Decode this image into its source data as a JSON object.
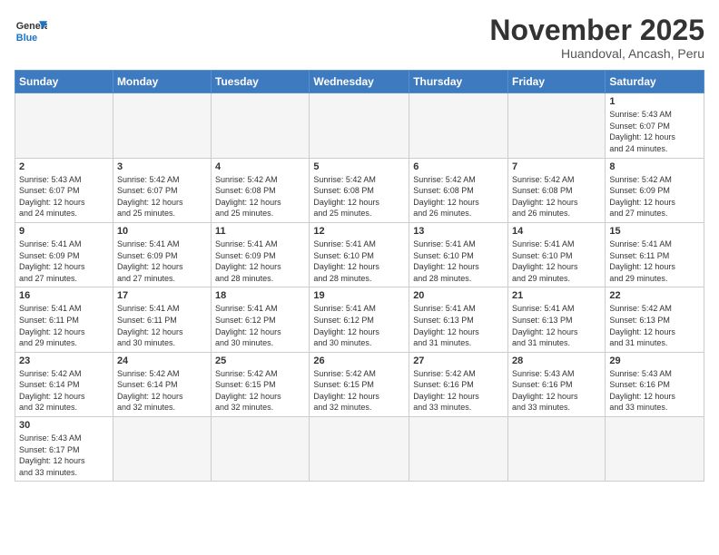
{
  "header": {
    "logo_general": "General",
    "logo_blue": "Blue",
    "month": "November 2025",
    "location": "Huandoval, Ancash, Peru"
  },
  "days_of_week": [
    "Sunday",
    "Monday",
    "Tuesday",
    "Wednesday",
    "Thursday",
    "Friday",
    "Saturday"
  ],
  "weeks": [
    [
      {
        "day": "",
        "info": ""
      },
      {
        "day": "",
        "info": ""
      },
      {
        "day": "",
        "info": ""
      },
      {
        "day": "",
        "info": ""
      },
      {
        "day": "",
        "info": ""
      },
      {
        "day": "",
        "info": ""
      },
      {
        "day": "1",
        "info": "Sunrise: 5:43 AM\nSunset: 6:07 PM\nDaylight: 12 hours\nand 24 minutes."
      }
    ],
    [
      {
        "day": "2",
        "info": "Sunrise: 5:43 AM\nSunset: 6:07 PM\nDaylight: 12 hours\nand 24 minutes."
      },
      {
        "day": "3",
        "info": "Sunrise: 5:42 AM\nSunset: 6:07 PM\nDaylight: 12 hours\nand 25 minutes."
      },
      {
        "day": "4",
        "info": "Sunrise: 5:42 AM\nSunset: 6:08 PM\nDaylight: 12 hours\nand 25 minutes."
      },
      {
        "day": "5",
        "info": "Sunrise: 5:42 AM\nSunset: 6:08 PM\nDaylight: 12 hours\nand 25 minutes."
      },
      {
        "day": "6",
        "info": "Sunrise: 5:42 AM\nSunset: 6:08 PM\nDaylight: 12 hours\nand 26 minutes."
      },
      {
        "day": "7",
        "info": "Sunrise: 5:42 AM\nSunset: 6:08 PM\nDaylight: 12 hours\nand 26 minutes."
      },
      {
        "day": "8",
        "info": "Sunrise: 5:42 AM\nSunset: 6:09 PM\nDaylight: 12 hours\nand 27 minutes."
      }
    ],
    [
      {
        "day": "9",
        "info": "Sunrise: 5:41 AM\nSunset: 6:09 PM\nDaylight: 12 hours\nand 27 minutes."
      },
      {
        "day": "10",
        "info": "Sunrise: 5:41 AM\nSunset: 6:09 PM\nDaylight: 12 hours\nand 27 minutes."
      },
      {
        "day": "11",
        "info": "Sunrise: 5:41 AM\nSunset: 6:09 PM\nDaylight: 12 hours\nand 28 minutes."
      },
      {
        "day": "12",
        "info": "Sunrise: 5:41 AM\nSunset: 6:10 PM\nDaylight: 12 hours\nand 28 minutes."
      },
      {
        "day": "13",
        "info": "Sunrise: 5:41 AM\nSunset: 6:10 PM\nDaylight: 12 hours\nand 28 minutes."
      },
      {
        "day": "14",
        "info": "Sunrise: 5:41 AM\nSunset: 6:10 PM\nDaylight: 12 hours\nand 29 minutes."
      },
      {
        "day": "15",
        "info": "Sunrise: 5:41 AM\nSunset: 6:11 PM\nDaylight: 12 hours\nand 29 minutes."
      }
    ],
    [
      {
        "day": "16",
        "info": "Sunrise: 5:41 AM\nSunset: 6:11 PM\nDaylight: 12 hours\nand 29 minutes."
      },
      {
        "day": "17",
        "info": "Sunrise: 5:41 AM\nSunset: 6:11 PM\nDaylight: 12 hours\nand 30 minutes."
      },
      {
        "day": "18",
        "info": "Sunrise: 5:41 AM\nSunset: 6:12 PM\nDaylight: 12 hours\nand 30 minutes."
      },
      {
        "day": "19",
        "info": "Sunrise: 5:41 AM\nSunset: 6:12 PM\nDaylight: 12 hours\nand 30 minutes."
      },
      {
        "day": "20",
        "info": "Sunrise: 5:41 AM\nSunset: 6:13 PM\nDaylight: 12 hours\nand 31 minutes."
      },
      {
        "day": "21",
        "info": "Sunrise: 5:41 AM\nSunset: 6:13 PM\nDaylight: 12 hours\nand 31 minutes."
      },
      {
        "day": "22",
        "info": "Sunrise: 5:42 AM\nSunset: 6:13 PM\nDaylight: 12 hours\nand 31 minutes."
      }
    ],
    [
      {
        "day": "23",
        "info": "Sunrise: 5:42 AM\nSunset: 6:14 PM\nDaylight: 12 hours\nand 32 minutes."
      },
      {
        "day": "24",
        "info": "Sunrise: 5:42 AM\nSunset: 6:14 PM\nDaylight: 12 hours\nand 32 minutes."
      },
      {
        "day": "25",
        "info": "Sunrise: 5:42 AM\nSunset: 6:15 PM\nDaylight: 12 hours\nand 32 minutes."
      },
      {
        "day": "26",
        "info": "Sunrise: 5:42 AM\nSunset: 6:15 PM\nDaylight: 12 hours\nand 32 minutes."
      },
      {
        "day": "27",
        "info": "Sunrise: 5:42 AM\nSunset: 6:16 PM\nDaylight: 12 hours\nand 33 minutes."
      },
      {
        "day": "28",
        "info": "Sunrise: 5:43 AM\nSunset: 6:16 PM\nDaylight: 12 hours\nand 33 minutes."
      },
      {
        "day": "29",
        "info": "Sunrise: 5:43 AM\nSunset: 6:16 PM\nDaylight: 12 hours\nand 33 minutes."
      }
    ],
    [
      {
        "day": "30",
        "info": "Sunrise: 5:43 AM\nSunset: 6:17 PM\nDaylight: 12 hours\nand 33 minutes."
      },
      {
        "day": "",
        "info": ""
      },
      {
        "day": "",
        "info": ""
      },
      {
        "day": "",
        "info": ""
      },
      {
        "day": "",
        "info": ""
      },
      {
        "day": "",
        "info": ""
      },
      {
        "day": "",
        "info": ""
      }
    ]
  ]
}
